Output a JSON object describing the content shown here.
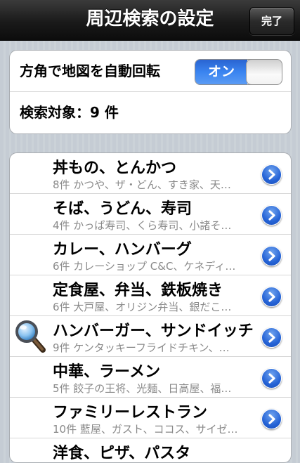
{
  "navbar": {
    "title": "周辺検索の設定",
    "done_label": "完了"
  },
  "settings": {
    "auto_rotate_label": "方角で地図を自動回転",
    "auto_rotate_state": "オン",
    "target_count_label": "検索対象：9 件"
  },
  "colors": {
    "toggle_on": "#3a84f0",
    "disclosure": "#2563d6",
    "navbar": "#1a1a1a"
  },
  "categories": [
    {
      "title": "丼もの、とんかつ",
      "subtitle": "8件 かつや、ザ・どん、すき家、天…"
    },
    {
      "title": "そば、うどん、寿司",
      "subtitle": "4件 かっぱ寿司、くら寿司、小諸そ…"
    },
    {
      "title": "カレー、ハンバーグ",
      "subtitle": "6件 カレーショップ C&C、ケネディ…"
    },
    {
      "title": "定食屋、弁当、鉄板焼き",
      "subtitle": "6件 大戸屋、オリジン弁当、銀だこ…"
    },
    {
      "title": "ハンバーガー、サンドイッチ",
      "subtitle": "9件 ケンタッキーフライドチキン、…"
    },
    {
      "title": "中華、ラーメン",
      "subtitle": "5件 餃子の王将、光麺、日高屋、福…"
    },
    {
      "title": "ファミリーレストラン",
      "subtitle": "10件 藍屋、ガスト、ココス、サイゼ…"
    },
    {
      "title": "洋食、ピザ、パスタ",
      "subtitle": ""
    }
  ],
  "icons": {
    "disclosure": "chevron-right-circle-icon",
    "highlight": "magnifying-glass-icon"
  }
}
